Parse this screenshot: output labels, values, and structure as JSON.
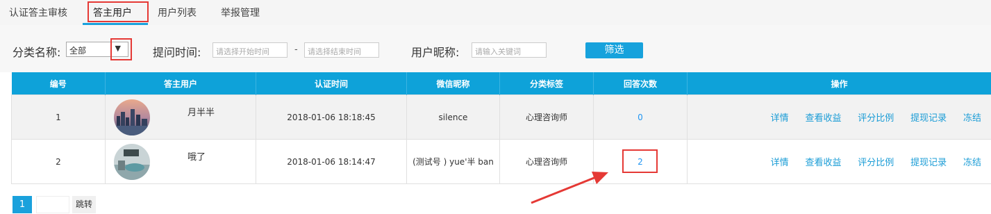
{
  "tabs": [
    {
      "label": "认证答主审核",
      "active": false
    },
    {
      "label": "答主用户",
      "active": true
    },
    {
      "label": "用户列表",
      "active": false
    },
    {
      "label": "举报管理",
      "active": false
    }
  ],
  "filters": {
    "category_label": "分类名称:",
    "category_value": "全部",
    "time_label": "提问时间:",
    "start_placeholder": "请选择开始时间",
    "range_sep": "-",
    "end_placeholder": "请选择结束时间",
    "nickname_label": "用户昵称:",
    "nickname_placeholder": "请输入关键词",
    "submit_label": "筛选"
  },
  "table": {
    "headers": [
      "编号",
      "答主用户",
      "认证时间",
      "微信昵称",
      "分类标签",
      "回答次数",
      "操作"
    ],
    "rows": [
      {
        "id": "1",
        "user": "月半半",
        "time": "2018-01-06 18:18:45",
        "wechat": "silence",
        "tag": "心理咨询师",
        "count": "0"
      },
      {
        "id": "2",
        "user": "哦了",
        "time": "2018-01-06 18:14:47",
        "wechat": "(测试号 ) yue'半 ban",
        "tag": "心理咨询师",
        "count": "2"
      }
    ],
    "actions": [
      "详情",
      "查看收益",
      "评分比例",
      "提现记录",
      "冻结"
    ]
  },
  "pager": {
    "current": "1",
    "jump_label": "跳转"
  },
  "colors": {
    "accent": "#0ea2d9",
    "highlight": "#e53935"
  }
}
